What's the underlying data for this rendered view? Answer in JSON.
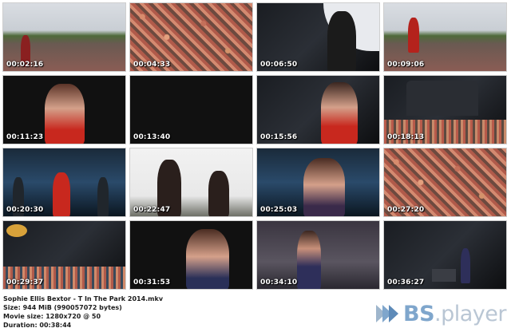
{
  "thumbnails": [
    {
      "timecode": "00:02:16",
      "scene": "sky"
    },
    {
      "timecode": "00:04:33",
      "scene": "crowd"
    },
    {
      "timecode": "00:06:50",
      "scene": "stage"
    },
    {
      "timecode": "00:09:06",
      "scene": "sky"
    },
    {
      "timecode": "00:11:23",
      "scene": "dark"
    },
    {
      "timecode": "00:13:40",
      "scene": "dark"
    },
    {
      "timecode": "00:15:56",
      "scene": "stage"
    },
    {
      "timecode": "00:18:13",
      "scene": "stage"
    },
    {
      "timecode": "00:20:30",
      "scene": "blue"
    },
    {
      "timecode": "00:22:47",
      "scene": "white"
    },
    {
      "timecode": "00:25:03",
      "scene": "blue"
    },
    {
      "timecode": "00:27:20",
      "scene": "crowd"
    },
    {
      "timecode": "00:29:37",
      "scene": "stage"
    },
    {
      "timecode": "00:31:53",
      "scene": "dark"
    },
    {
      "timecode": "00:34:10",
      "scene": "purple"
    },
    {
      "timecode": "00:36:27",
      "scene": "stage"
    }
  ],
  "file_info": {
    "filename": "Sophie Ellis Bextor - T In The Park 2014.mkv",
    "size": "Size: 944 MiB (990057072 bytes)",
    "movie_size": "Movie size: 1280x720 @ 50",
    "duration": "Duration: 00:38:44"
  },
  "logo": {
    "prefix": "BS",
    "suffix": ".player"
  },
  "colors": {
    "accent": "#7fa6cc",
    "logo_text": "#b9c6d4",
    "dress_red": "#c8281e"
  }
}
